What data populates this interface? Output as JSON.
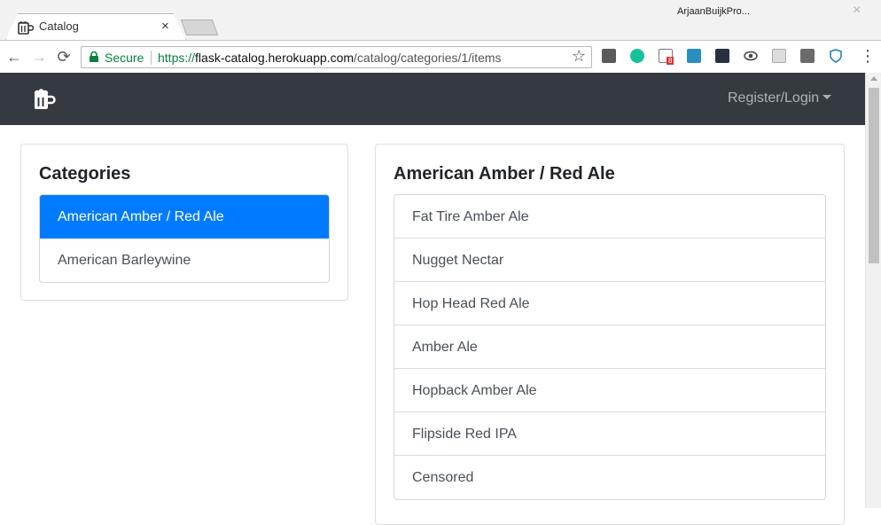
{
  "browser": {
    "tab_title": "Catalog",
    "tab_close": "×",
    "profile": "ArjaanBuijkPro...",
    "window_close": "×",
    "secure_label": "Secure",
    "url_scheme": "https://",
    "url_host": "flask-catalog.herokuapp.com",
    "url_path": "/catalog/categories/1/items",
    "back": "←",
    "forward": "→",
    "reload": "⟳",
    "bookmark": "☆",
    "menu": "⋮",
    "extensions": [
      "stop-icon",
      "grammarly-icon",
      "badge-icon",
      "ext-icon",
      "ext-dark-icon",
      "eye-icon",
      "box-icon",
      "jb-icon",
      "shield-icon"
    ],
    "extension_badge": "8"
  },
  "navbar": {
    "brand_icon": "beer-mug-icon",
    "login_label": "Register/Login"
  },
  "categories": {
    "title": "Categories",
    "items": [
      {
        "label": "American Amber / Red Ale",
        "active": true
      },
      {
        "label": "American Barleywine",
        "active": false
      }
    ]
  },
  "items_panel": {
    "title": "American Amber / Red Ale",
    "items": [
      "Fat Tire Amber Ale",
      "Nugget Nectar",
      "Hop Head Red Ale",
      "Amber Ale",
      "Hopback Amber Ale",
      "Flipside Red IPA",
      "Censored"
    ]
  },
  "colors": {
    "navbar": "#343a40",
    "active": "#007bff",
    "secure": "#0b8043"
  }
}
